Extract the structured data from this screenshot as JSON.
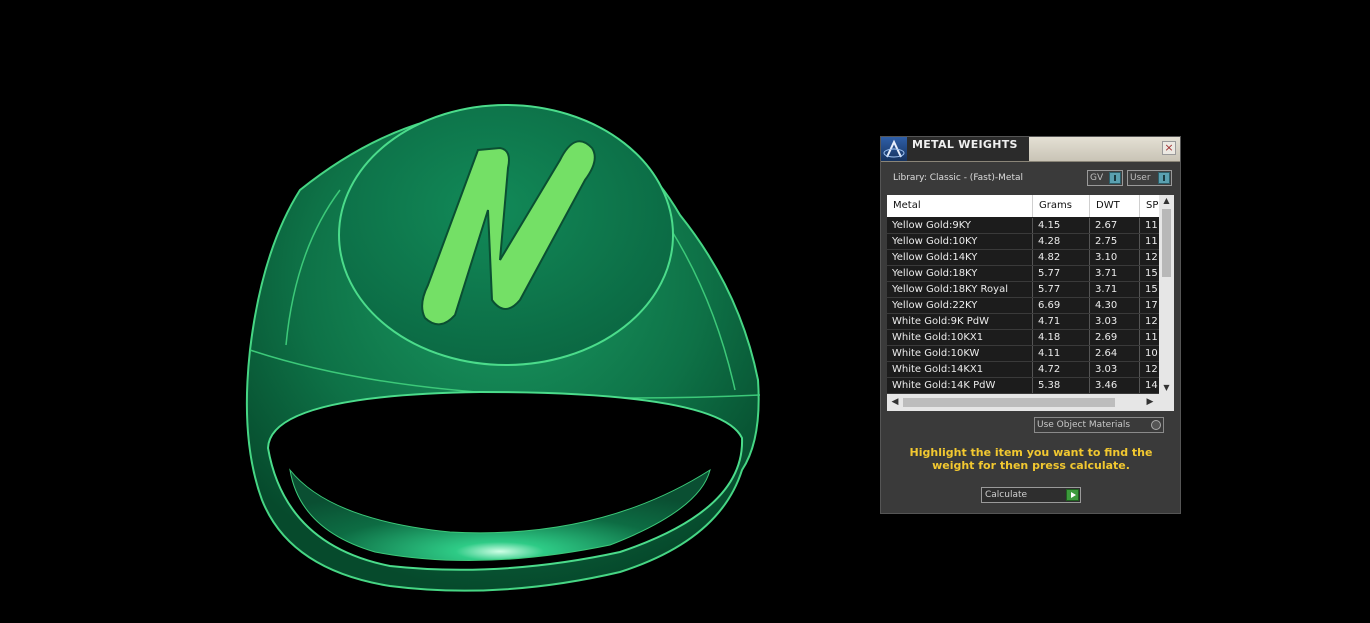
{
  "panel": {
    "title": "METAL WEIGHTS",
    "close_glyph": "×",
    "library": "Library: Classic - (Fast)-Metal",
    "gv_toggle": "GV",
    "user_toggle": "User",
    "columns": [
      "Metal",
      "Grams",
      "DWT",
      "SP"
    ],
    "rows": [
      {
        "metal": "Yellow Gold:9KY",
        "grams": "4.15",
        "dwt": "2.67",
        "sp": "11"
      },
      {
        "metal": "Yellow Gold:10KY",
        "grams": "4.28",
        "dwt": "2.75",
        "sp": "11"
      },
      {
        "metal": "Yellow Gold:14KY",
        "grams": "4.82",
        "dwt": "3.10",
        "sp": "12"
      },
      {
        "metal": "Yellow Gold:18KY",
        "grams": "5.77",
        "dwt": "3.71",
        "sp": "15"
      },
      {
        "metal": "Yellow Gold:18KY Royal",
        "grams": "5.77",
        "dwt": "3.71",
        "sp": "15"
      },
      {
        "metal": "Yellow Gold:22KY",
        "grams": "6.69",
        "dwt": "4.30",
        "sp": "17"
      },
      {
        "metal": "White Gold:9K PdW",
        "grams": "4.71",
        "dwt": "3.03",
        "sp": "12"
      },
      {
        "metal": "White Gold:10KX1",
        "grams": "4.18",
        "dwt": "2.69",
        "sp": "11"
      },
      {
        "metal": "White Gold:10KW",
        "grams": "4.11",
        "dwt": "2.64",
        "sp": "10"
      },
      {
        "metal": "White Gold:14KX1",
        "grams": "4.72",
        "dwt": "3.03",
        "sp": "12"
      },
      {
        "metal": "White Gold:14K PdW",
        "grams": "5.38",
        "dwt": "3.46",
        "sp": "14"
      }
    ],
    "use_object_materials": "Use Object Materials",
    "hint": "Highlight the item you want to find the weight for then press calculate.",
    "calculate_label": "Calculate"
  },
  "icons": {
    "app": "app-logo-icon",
    "close": "close-icon",
    "scroll_up": "scroll-up-arrow-icon",
    "scroll_down": "scroll-down-arrow-icon",
    "scroll_left": "scroll-left-arrow-icon",
    "scroll_right": "scroll-right-arrow-icon",
    "calculate": "play-arrow-icon"
  },
  "colors": {
    "ring": "#0f7a4f",
    "ring_edge": "#42d37f",
    "monogram": "#74e066",
    "hint_text": "#f2c830",
    "background": "#000000"
  }
}
